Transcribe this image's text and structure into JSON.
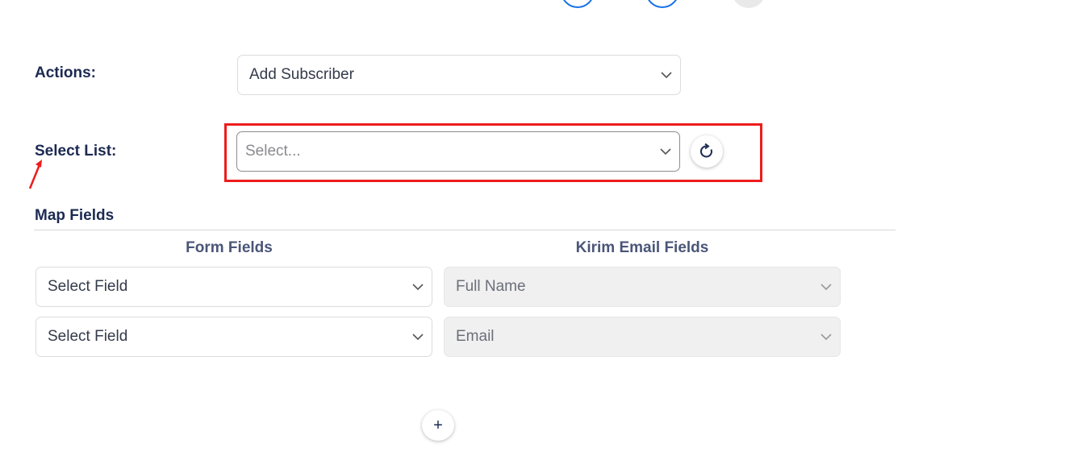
{
  "steps": [
    {
      "name": "step-1"
    },
    {
      "name": "step-2"
    },
    {
      "name": "step-3"
    }
  ],
  "actions": {
    "label": "Actions:",
    "value": "Add Subscriber"
  },
  "select_list": {
    "label": "Select List:",
    "placeholder": "Select...",
    "refresh_icon": "refresh-icon",
    "highlight_color": "#ee1c1c"
  },
  "map_fields": {
    "title": "Map Fields",
    "form_fields_header": "Form Fields",
    "service_fields_header": "Kirim Email Fields",
    "rows": [
      {
        "form_field": "Select Field",
        "service_field": "Full Name"
      },
      {
        "form_field": "Select Field",
        "service_field": "Email"
      }
    ],
    "add_icon": "plus-icon",
    "add_label": "+"
  },
  "colors": {
    "accent": "#1a73e8",
    "text": "#1c2a52",
    "highlight": "#ee1c1c"
  }
}
